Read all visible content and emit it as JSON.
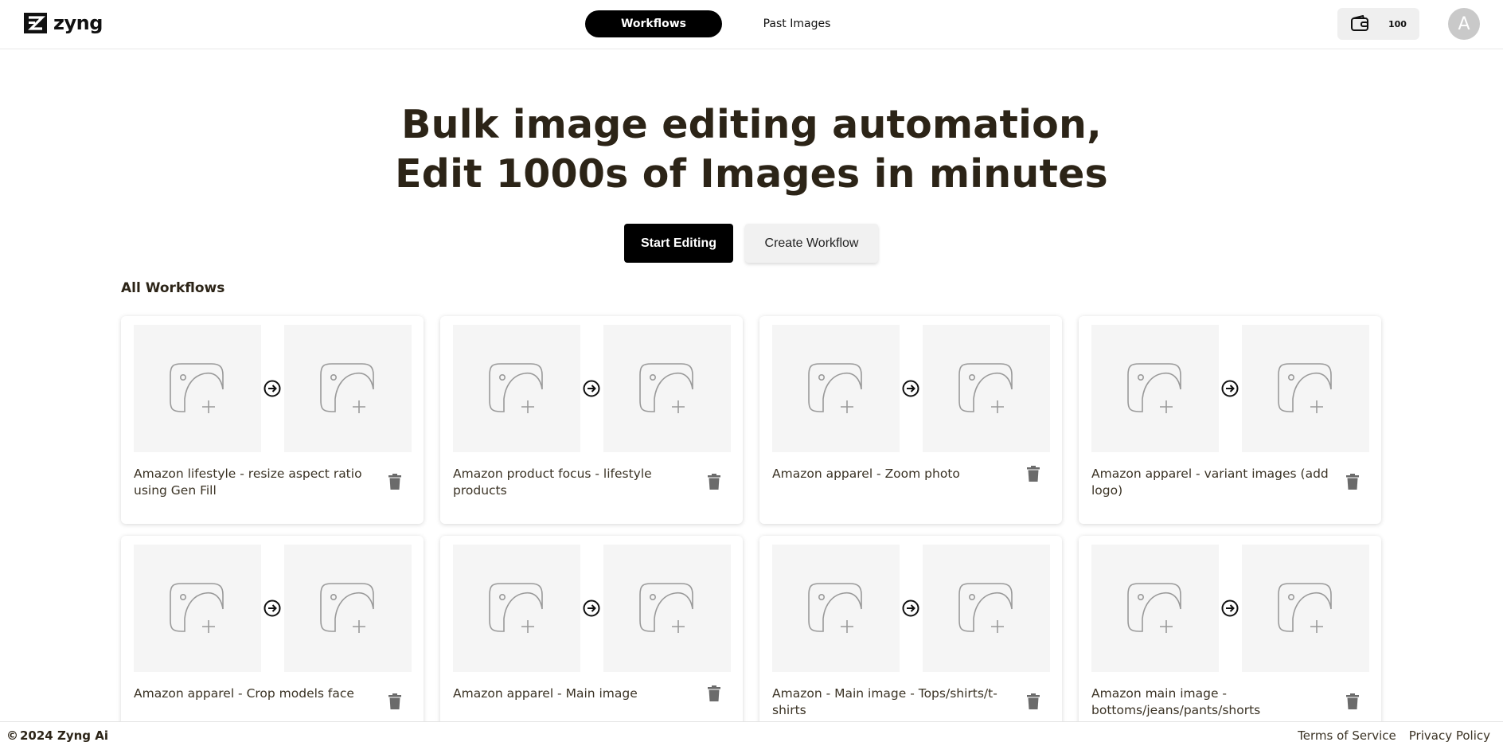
{
  "header": {
    "logo_icon": "zyng-logo-icon",
    "logo_text": "zyng",
    "tabs": [
      {
        "label": "Workflows",
        "active": true
      },
      {
        "label": "Past Images",
        "active": false
      }
    ],
    "credits_icon": "wallet-icon",
    "credits_count": "100",
    "avatar_letter": "A"
  },
  "hero": {
    "title_line1": "Bulk image editing automation,",
    "title_line2": "Edit 1000s of Images in minutes",
    "start_button": "Start Editing",
    "create_button": "Create Workflow"
  },
  "workflows": {
    "section_title": "All Workflows",
    "thumb_icon": "image-add-icon",
    "arrow_icon": "arrow-circle-right-icon",
    "delete_icon": "trash-icon",
    "items": [
      {
        "title": "Amazon lifestyle - resize aspect ratio using Gen Fill"
      },
      {
        "title": "Amazon product focus - lifestyle products"
      },
      {
        "title": "Amazon apparel - Zoom photo"
      },
      {
        "title": "Amazon apparel - variant images (add logo)"
      },
      {
        "title": "Amazon apparel - Crop models face"
      },
      {
        "title": "Amazon apparel - Main image"
      },
      {
        "title": "Amazon - Main image - Tops/shirts/t-shirts"
      },
      {
        "title": "Amazon main image - bottoms/jeans/pants/shorts"
      }
    ]
  },
  "footer": {
    "copyright_symbol": "©",
    "copyright_text": "2024 Zyng Ai",
    "terms": "Terms of Service",
    "privacy": "Privacy Policy"
  },
  "colors": {
    "primary": "#000000",
    "heading": "#2c2417",
    "thumb_bg": "#f5f5f5",
    "icon_gray": "#6b6b6b"
  }
}
